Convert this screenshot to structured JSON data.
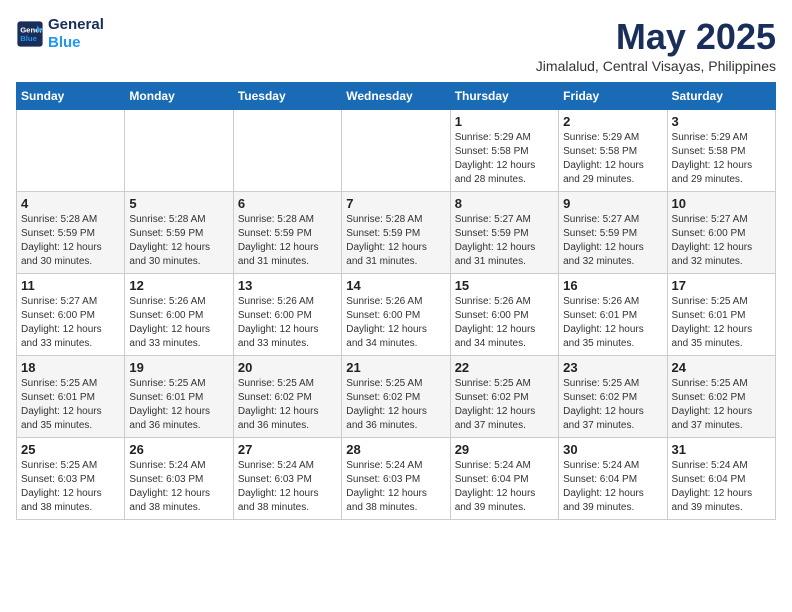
{
  "logo": {
    "line1": "General",
    "line2": "Blue"
  },
  "title": "May 2025",
  "location": "Jimalalud, Central Visayas, Philippines",
  "days_of_week": [
    "Sunday",
    "Monday",
    "Tuesday",
    "Wednesday",
    "Thursday",
    "Friday",
    "Saturday"
  ],
  "weeks": [
    [
      {
        "day": "",
        "info": ""
      },
      {
        "day": "",
        "info": ""
      },
      {
        "day": "",
        "info": ""
      },
      {
        "day": "",
        "info": ""
      },
      {
        "day": "1",
        "info": "Sunrise: 5:29 AM\nSunset: 5:58 PM\nDaylight: 12 hours\nand 28 minutes."
      },
      {
        "day": "2",
        "info": "Sunrise: 5:29 AM\nSunset: 5:58 PM\nDaylight: 12 hours\nand 29 minutes."
      },
      {
        "day": "3",
        "info": "Sunrise: 5:29 AM\nSunset: 5:58 PM\nDaylight: 12 hours\nand 29 minutes."
      }
    ],
    [
      {
        "day": "4",
        "info": "Sunrise: 5:28 AM\nSunset: 5:59 PM\nDaylight: 12 hours\nand 30 minutes."
      },
      {
        "day": "5",
        "info": "Sunrise: 5:28 AM\nSunset: 5:59 PM\nDaylight: 12 hours\nand 30 minutes."
      },
      {
        "day": "6",
        "info": "Sunrise: 5:28 AM\nSunset: 5:59 PM\nDaylight: 12 hours\nand 31 minutes."
      },
      {
        "day": "7",
        "info": "Sunrise: 5:28 AM\nSunset: 5:59 PM\nDaylight: 12 hours\nand 31 minutes."
      },
      {
        "day": "8",
        "info": "Sunrise: 5:27 AM\nSunset: 5:59 PM\nDaylight: 12 hours\nand 31 minutes."
      },
      {
        "day": "9",
        "info": "Sunrise: 5:27 AM\nSunset: 5:59 PM\nDaylight: 12 hours\nand 32 minutes."
      },
      {
        "day": "10",
        "info": "Sunrise: 5:27 AM\nSunset: 6:00 PM\nDaylight: 12 hours\nand 32 minutes."
      }
    ],
    [
      {
        "day": "11",
        "info": "Sunrise: 5:27 AM\nSunset: 6:00 PM\nDaylight: 12 hours\nand 33 minutes."
      },
      {
        "day": "12",
        "info": "Sunrise: 5:26 AM\nSunset: 6:00 PM\nDaylight: 12 hours\nand 33 minutes."
      },
      {
        "day": "13",
        "info": "Sunrise: 5:26 AM\nSunset: 6:00 PM\nDaylight: 12 hours\nand 33 minutes."
      },
      {
        "day": "14",
        "info": "Sunrise: 5:26 AM\nSunset: 6:00 PM\nDaylight: 12 hours\nand 34 minutes."
      },
      {
        "day": "15",
        "info": "Sunrise: 5:26 AM\nSunset: 6:00 PM\nDaylight: 12 hours\nand 34 minutes."
      },
      {
        "day": "16",
        "info": "Sunrise: 5:26 AM\nSunset: 6:01 PM\nDaylight: 12 hours\nand 35 minutes."
      },
      {
        "day": "17",
        "info": "Sunrise: 5:25 AM\nSunset: 6:01 PM\nDaylight: 12 hours\nand 35 minutes."
      }
    ],
    [
      {
        "day": "18",
        "info": "Sunrise: 5:25 AM\nSunset: 6:01 PM\nDaylight: 12 hours\nand 35 minutes."
      },
      {
        "day": "19",
        "info": "Sunrise: 5:25 AM\nSunset: 6:01 PM\nDaylight: 12 hours\nand 36 minutes."
      },
      {
        "day": "20",
        "info": "Sunrise: 5:25 AM\nSunset: 6:02 PM\nDaylight: 12 hours\nand 36 minutes."
      },
      {
        "day": "21",
        "info": "Sunrise: 5:25 AM\nSunset: 6:02 PM\nDaylight: 12 hours\nand 36 minutes."
      },
      {
        "day": "22",
        "info": "Sunrise: 5:25 AM\nSunset: 6:02 PM\nDaylight: 12 hours\nand 37 minutes."
      },
      {
        "day": "23",
        "info": "Sunrise: 5:25 AM\nSunset: 6:02 PM\nDaylight: 12 hours\nand 37 minutes."
      },
      {
        "day": "24",
        "info": "Sunrise: 5:25 AM\nSunset: 6:02 PM\nDaylight: 12 hours\nand 37 minutes."
      }
    ],
    [
      {
        "day": "25",
        "info": "Sunrise: 5:25 AM\nSunset: 6:03 PM\nDaylight: 12 hours\nand 38 minutes."
      },
      {
        "day": "26",
        "info": "Sunrise: 5:24 AM\nSunset: 6:03 PM\nDaylight: 12 hours\nand 38 minutes."
      },
      {
        "day": "27",
        "info": "Sunrise: 5:24 AM\nSunset: 6:03 PM\nDaylight: 12 hours\nand 38 minutes."
      },
      {
        "day": "28",
        "info": "Sunrise: 5:24 AM\nSunset: 6:03 PM\nDaylight: 12 hours\nand 38 minutes."
      },
      {
        "day": "29",
        "info": "Sunrise: 5:24 AM\nSunset: 6:04 PM\nDaylight: 12 hours\nand 39 minutes."
      },
      {
        "day": "30",
        "info": "Sunrise: 5:24 AM\nSunset: 6:04 PM\nDaylight: 12 hours\nand 39 minutes."
      },
      {
        "day": "31",
        "info": "Sunrise: 5:24 AM\nSunset: 6:04 PM\nDaylight: 12 hours\nand 39 minutes."
      }
    ]
  ]
}
